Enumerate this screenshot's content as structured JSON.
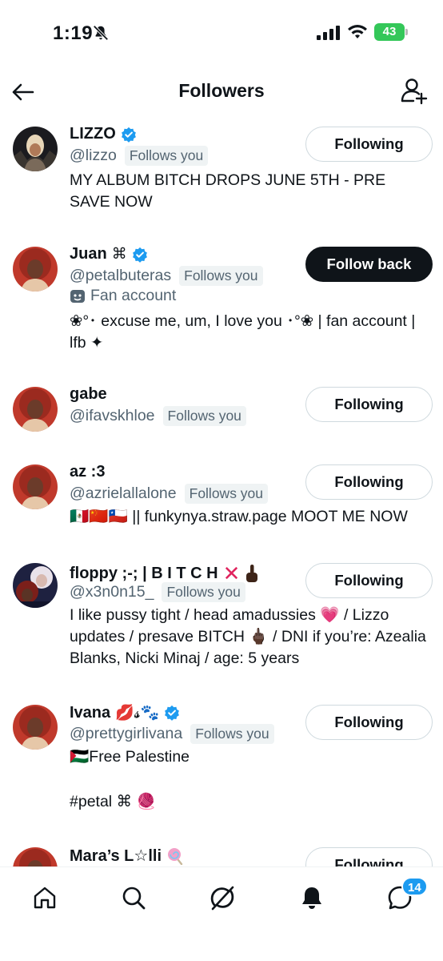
{
  "status_bar": {
    "time": "1:19",
    "battery": "43"
  },
  "header": {
    "title": "Followers"
  },
  "followers": [
    {
      "name": "LIZZO",
      "verified": true,
      "handle": "@lizzo",
      "follows_you": "Follows you",
      "bio": "MY ALBUM BITCH DROPS JUNE 5TH - PRE SAVE NOW",
      "button": "Following"
    },
    {
      "name": "Juan",
      "name_suffix": "⌘",
      "verified": true,
      "handle": "@petalbuteras",
      "follows_you": "Follows you",
      "fan_label": "Fan account",
      "bio": "❀°･ excuse me, um, I love you ･°❀ | fan account | lfb ✦",
      "button": "Follow back"
    },
    {
      "name": "gabe",
      "handle": "@ifavskhloe",
      "follows_you": "Follows you",
      "button": "Following"
    },
    {
      "name": "az :3",
      "handle": "@azrielallalone",
      "follows_you": "Follows you",
      "bio": "🇲🇽🇨🇳🇨🇱 || funkynya.straw.page MOOT ME NOW",
      "button": "Following"
    },
    {
      "name": "floppy ;-; | B I T C H",
      "handle": "@x3n0n15_",
      "follows_you": "Follows you",
      "bio": "I like pussy tight / head amadussies 💗 / Lizzo updates / presave BITCH 🖕🏿 / DNI if you’re: Azealia Blanks, Nicki Minaj / age: 5 years",
      "button": "Following"
    },
    {
      "name": "Ivana",
      "name_suffix": "💋𝓼🐾",
      "verified": true,
      "handle": "@prettygirlivana",
      "follows_you": "Follows you",
      "bio_line1": "🇵🇸Free Palestine",
      "bio_line2": "#petal ⌘ 🧶",
      "button": "Following"
    },
    {
      "name": "Mara’s L☆lli",
      "button": "Following"
    }
  ],
  "bottom_nav": {
    "items": [
      "home-icon",
      "search-icon",
      "grok-icon",
      "notifications-icon",
      "messages-icon"
    ],
    "messages_badge": "14"
  },
  "colors": {
    "verified": "#1d9bf0",
    "text": "#0f1419",
    "secondary": "#536471",
    "button_border": "#cfd9de",
    "battery": "#34c759"
  }
}
